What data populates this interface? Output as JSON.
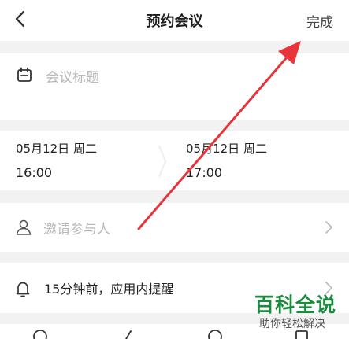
{
  "header": {
    "title": "预约会议",
    "done_label": "完成",
    "back_icon": "chevron-left-icon"
  },
  "meeting_title": {
    "icon": "calendar-icon",
    "placeholder": "会议标题"
  },
  "time": {
    "start_date": "05月12日 周二",
    "start_time": "16:00",
    "end_date": "05月12日 周二",
    "end_time": "17:00"
  },
  "invite": {
    "icon": "user-icon",
    "placeholder": "邀请参与人"
  },
  "reminder": {
    "icon": "bell-icon",
    "text": "15分钟前，应用内提醒"
  },
  "annotation": {
    "color": "#e8343a"
  },
  "watermark": {
    "title": "百科全说",
    "subtitle": "助你轻松解决"
  },
  "colors": {
    "background": "#f2f2f2",
    "card": "#ffffff",
    "placeholder": "#b8b8b8",
    "watermark_green": "#1a8a3c"
  }
}
